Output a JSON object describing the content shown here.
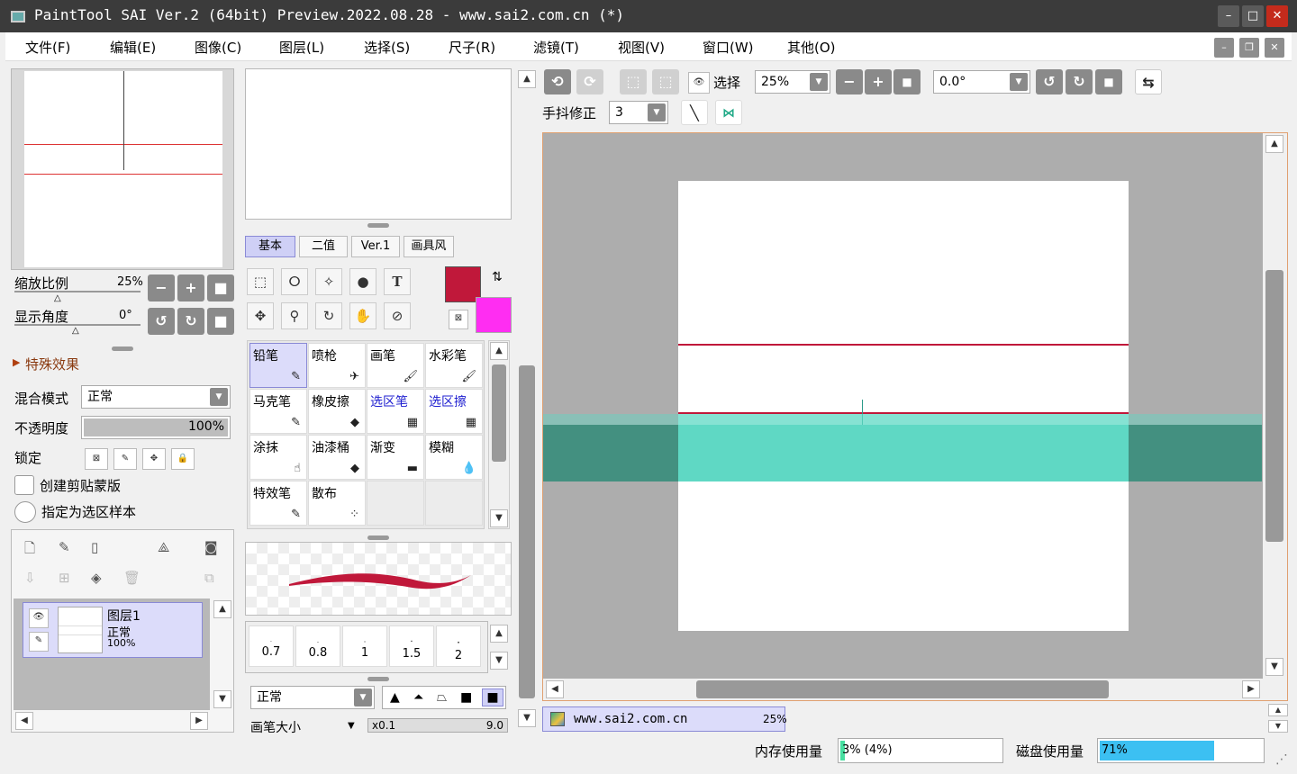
{
  "window": {
    "title": "PaintTool SAI Ver.2 (64bit) Preview.2022.08.28 - www.sai2.com.cn (*)",
    "minimize": "–",
    "maximize": "□",
    "close": "✕"
  },
  "menu": [
    "文件(F)",
    "编辑(E)",
    "图像(C)",
    "图层(L)",
    "选择(S)",
    "尺子(R)",
    "滤镜(T)",
    "视图(V)",
    "窗口(W)",
    "其他(O)"
  ],
  "navigator": {
    "zoom_label": "缩放比例",
    "zoom_value": "25%",
    "angle_label": "显示角度",
    "angle_value": "0°"
  },
  "effects": {
    "label": "特殊效果"
  },
  "layer_props": {
    "blend_label": "混合模式",
    "blend_value": "正常",
    "opacity_label": "不透明度",
    "opacity_value": "100%",
    "opacity": 1.0,
    "lock_label": "锁定",
    "clip_label": "创建剪贴蒙版",
    "sample_label": "指定为选区样本"
  },
  "layers": [
    {
      "name": "图层1",
      "mode": "正常",
      "opacity": "100%"
    }
  ],
  "tool_tabs": [
    "基本",
    "二值",
    "Ver.1",
    "画具风"
  ],
  "colors": {
    "primary": "#c0183a",
    "secondary": "#ff2df2",
    "selection": "#5fd8c4"
  },
  "brushes": [
    {
      "name": "铅笔",
      "icon": "✎",
      "selected": true
    },
    {
      "name": "喷枪",
      "icon": "✈"
    },
    {
      "name": "画笔",
      "icon": "🖌"
    },
    {
      "name": "水彩笔",
      "icon": "🖌"
    },
    {
      "name": "马克笔",
      "icon": "✎"
    },
    {
      "name": "橡皮擦",
      "icon": "◆"
    },
    {
      "name": "选区笔",
      "icon": "▦",
      "blue": true
    },
    {
      "name": "选区擦",
      "icon": "▦",
      "blue": true
    },
    {
      "name": "涂抹",
      "icon": "☝"
    },
    {
      "name": "油漆桶",
      "icon": "◆"
    },
    {
      "name": "渐变",
      "icon": "▬"
    },
    {
      "name": "模糊",
      "icon": "💧"
    },
    {
      "name": "特效笔",
      "icon": "✎"
    },
    {
      "name": "散布",
      "icon": "⁘"
    }
  ],
  "brush_sizes": [
    "0.7",
    "0.8",
    "1",
    "1.5",
    "2"
  ],
  "brush_mode": "正常",
  "brush_size_label": "画笔大小",
  "brush_size_mult": "x0.1",
  "brush_size_value": "9.0",
  "toolbar": {
    "select_label": "选择",
    "zoom": "25%",
    "angle": "0.0°",
    "stabilizer_label": "手抖修正",
    "stabilizer_value": "3"
  },
  "doc_tab": {
    "name": "www.sai2.com.cn",
    "zoom": "25%"
  },
  "status": {
    "mem_label": "内存使用量",
    "mem_value": "3% (4%)",
    "mem_pct": 3,
    "disk_label": "磁盘使用量",
    "disk_value": "71%",
    "disk_pct": 71
  }
}
